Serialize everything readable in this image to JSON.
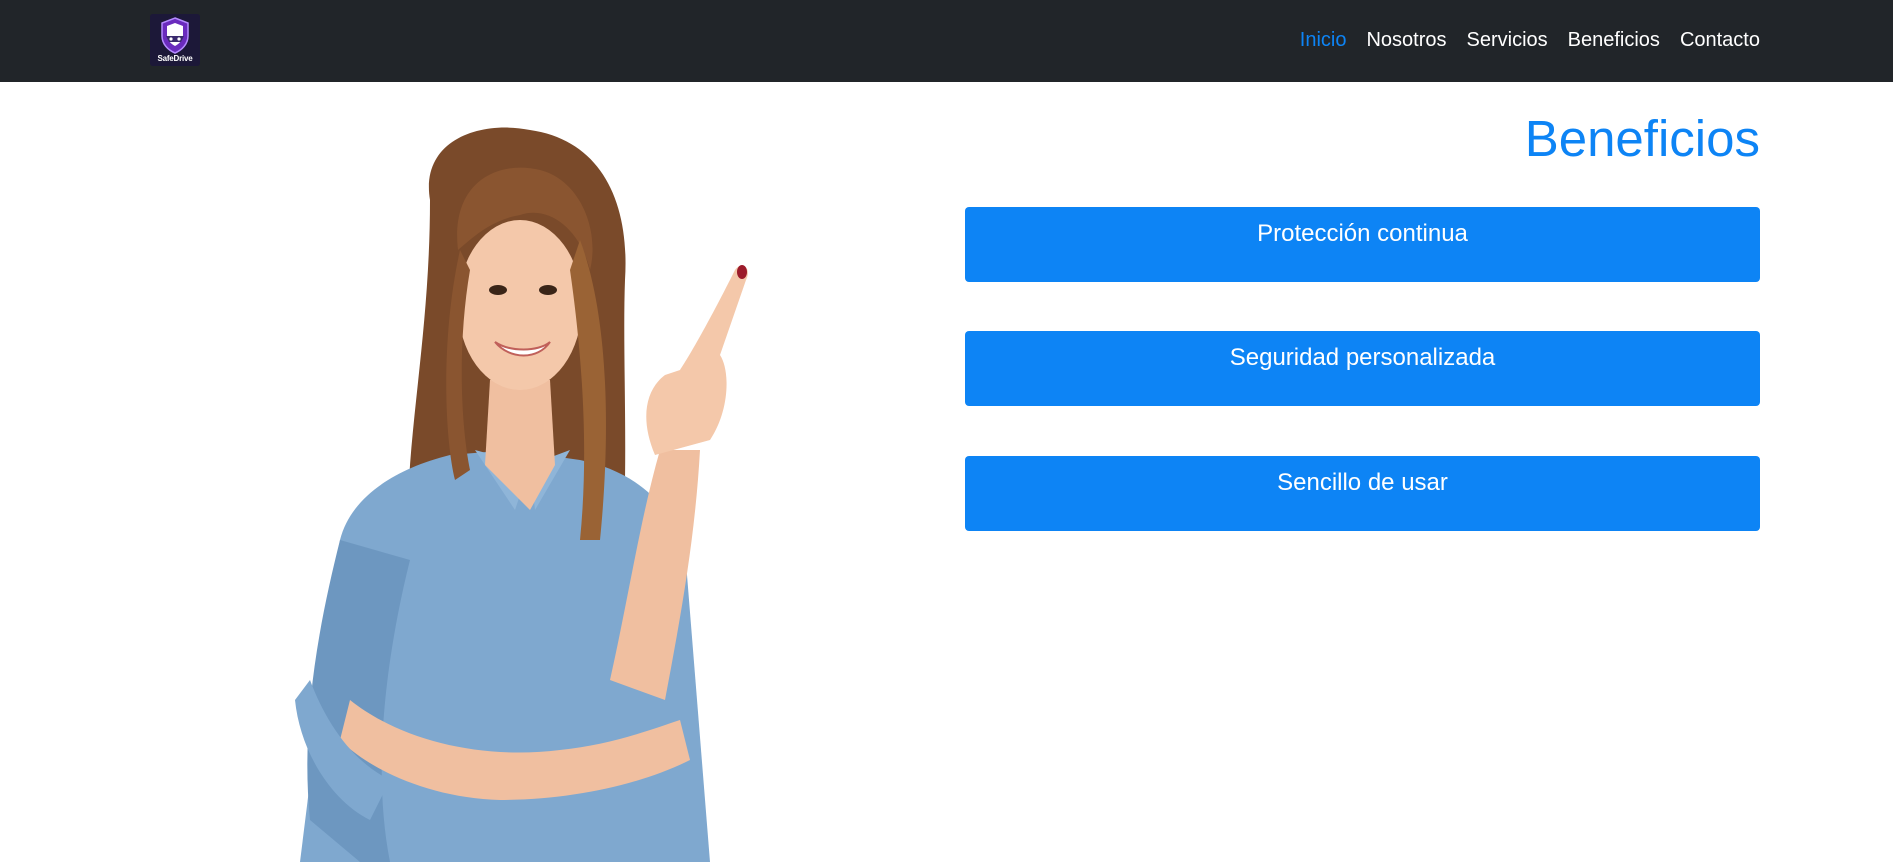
{
  "brand": {
    "logo_text": "SafeDrive"
  },
  "nav": {
    "items": [
      {
        "label": "Inicio",
        "active": true
      },
      {
        "label": "Nosotros",
        "active": false
      },
      {
        "label": "Servicios",
        "active": false
      },
      {
        "label": "Beneficios",
        "active": false
      },
      {
        "label": "Contacto",
        "active": false
      }
    ]
  },
  "benefits": {
    "title": "Beneficios",
    "items": [
      {
        "label": "Protección continua"
      },
      {
        "label": "Seguridad personalizada"
      },
      {
        "label": "Sencillo de usar"
      }
    ]
  },
  "colors": {
    "navbar_bg": "#212529",
    "accent": "#0d84f5",
    "nav_text": "#ffffff"
  }
}
